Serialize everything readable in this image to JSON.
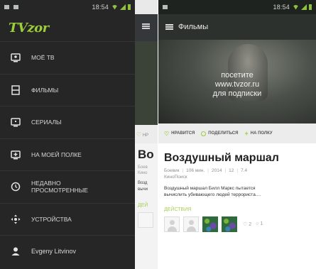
{
  "left_screen": {
    "status_bar": {
      "time": "18:54"
    },
    "logo": "TVzor",
    "nav_items": [
      {
        "label": "МОЁ ТВ",
        "icon": "my-tv-icon"
      },
      {
        "label": "ФИЛЬМЫ",
        "icon": "film-icon"
      },
      {
        "label": "СЕРИАЛЫ",
        "icon": "series-icon"
      },
      {
        "label": "НА МОЕЙ ПОЛКЕ",
        "icon": "shelf-icon"
      },
      {
        "label": "НЕДАВНО\nПРОСМОТРЕННЫЕ",
        "icon": "clock-icon"
      },
      {
        "label": "УСТРОЙСТВА",
        "icon": "devices-icon"
      },
      {
        "label": "Evgeny Litvinov",
        "icon": "user-icon"
      }
    ],
    "peek": {
      "action": "НР",
      "title": "Во",
      "meta": "Боев\nКино",
      "desc": "Возд\nвычи",
      "section": "ДЕЙ"
    }
  },
  "right_screen": {
    "status_bar": {
      "time": "18:54"
    },
    "app_bar_title": "Фильмы",
    "hero_promo": "посетите\nwww.tvzor.ru\nдля подписки",
    "actions": {
      "like": "НРАВИТСЯ",
      "share": "ПОДЕЛИТЬСЯ",
      "shelf": "НА ПОЛКУ"
    },
    "film": {
      "title": "Воздушный маршал",
      "genre": "Боевик",
      "duration": "106 мин.",
      "year": "2014",
      "age": "12",
      "rating": "7.4",
      "source": "КиноПоиск",
      "description": "Воздушный маршал Билл Маркс пытается\nвычислить убивающего людей террориста...."
    },
    "section_title": "ДЕЙСТВИЯ",
    "counts": {
      "likes": "2",
      "comments": "1"
    }
  },
  "colors": {
    "accent_green": "#9ccd3a",
    "drawer_bg": "#262626",
    "app_bar_bg": "#2c312d"
  }
}
